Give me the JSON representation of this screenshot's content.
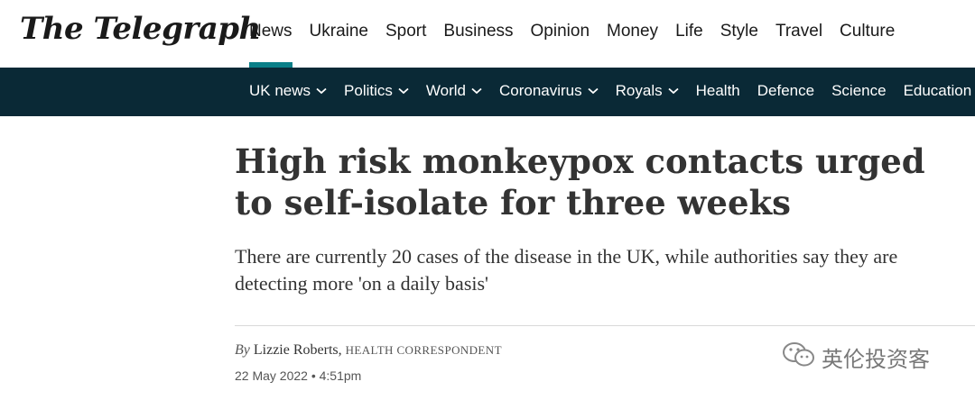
{
  "brand": {
    "logo_text": "The Telegraph"
  },
  "main_nav": [
    {
      "label": "News"
    },
    {
      "label": "Ukraine"
    },
    {
      "label": "Sport"
    },
    {
      "label": "Business"
    },
    {
      "label": "Opinion"
    },
    {
      "label": "Money"
    },
    {
      "label": "Life"
    },
    {
      "label": "Style"
    },
    {
      "label": "Travel"
    },
    {
      "label": "Culture"
    }
  ],
  "sub_nav": [
    {
      "label": "UK news",
      "has_dropdown": true
    },
    {
      "label": "Politics",
      "has_dropdown": true
    },
    {
      "label": "World",
      "has_dropdown": true
    },
    {
      "label": "Coronavirus",
      "has_dropdown": true
    },
    {
      "label": "Royals",
      "has_dropdown": true
    },
    {
      "label": "Health",
      "has_dropdown": false
    },
    {
      "label": "Defence",
      "has_dropdown": false
    },
    {
      "label": "Science",
      "has_dropdown": false
    },
    {
      "label": "Education",
      "has_dropdown": false
    }
  ],
  "article": {
    "headline": "High risk monkeypox contacts urged to self-isolate for three weeks",
    "standfirst": "There are currently 20 cases of the disease in the UK, while authorities say they are detecting more 'on a daily basis'",
    "byline_prefix": "By",
    "author": "Lizzie Roberts,",
    "role": "HEALTH CORRESPONDENT",
    "date": "22 May 2022 • 4:51pm"
  },
  "watermark": {
    "text": "英伦投资客",
    "icon": "wechat-icon"
  },
  "colors": {
    "subnav_bg": "#0a2936",
    "accent": "#0a7f88"
  }
}
